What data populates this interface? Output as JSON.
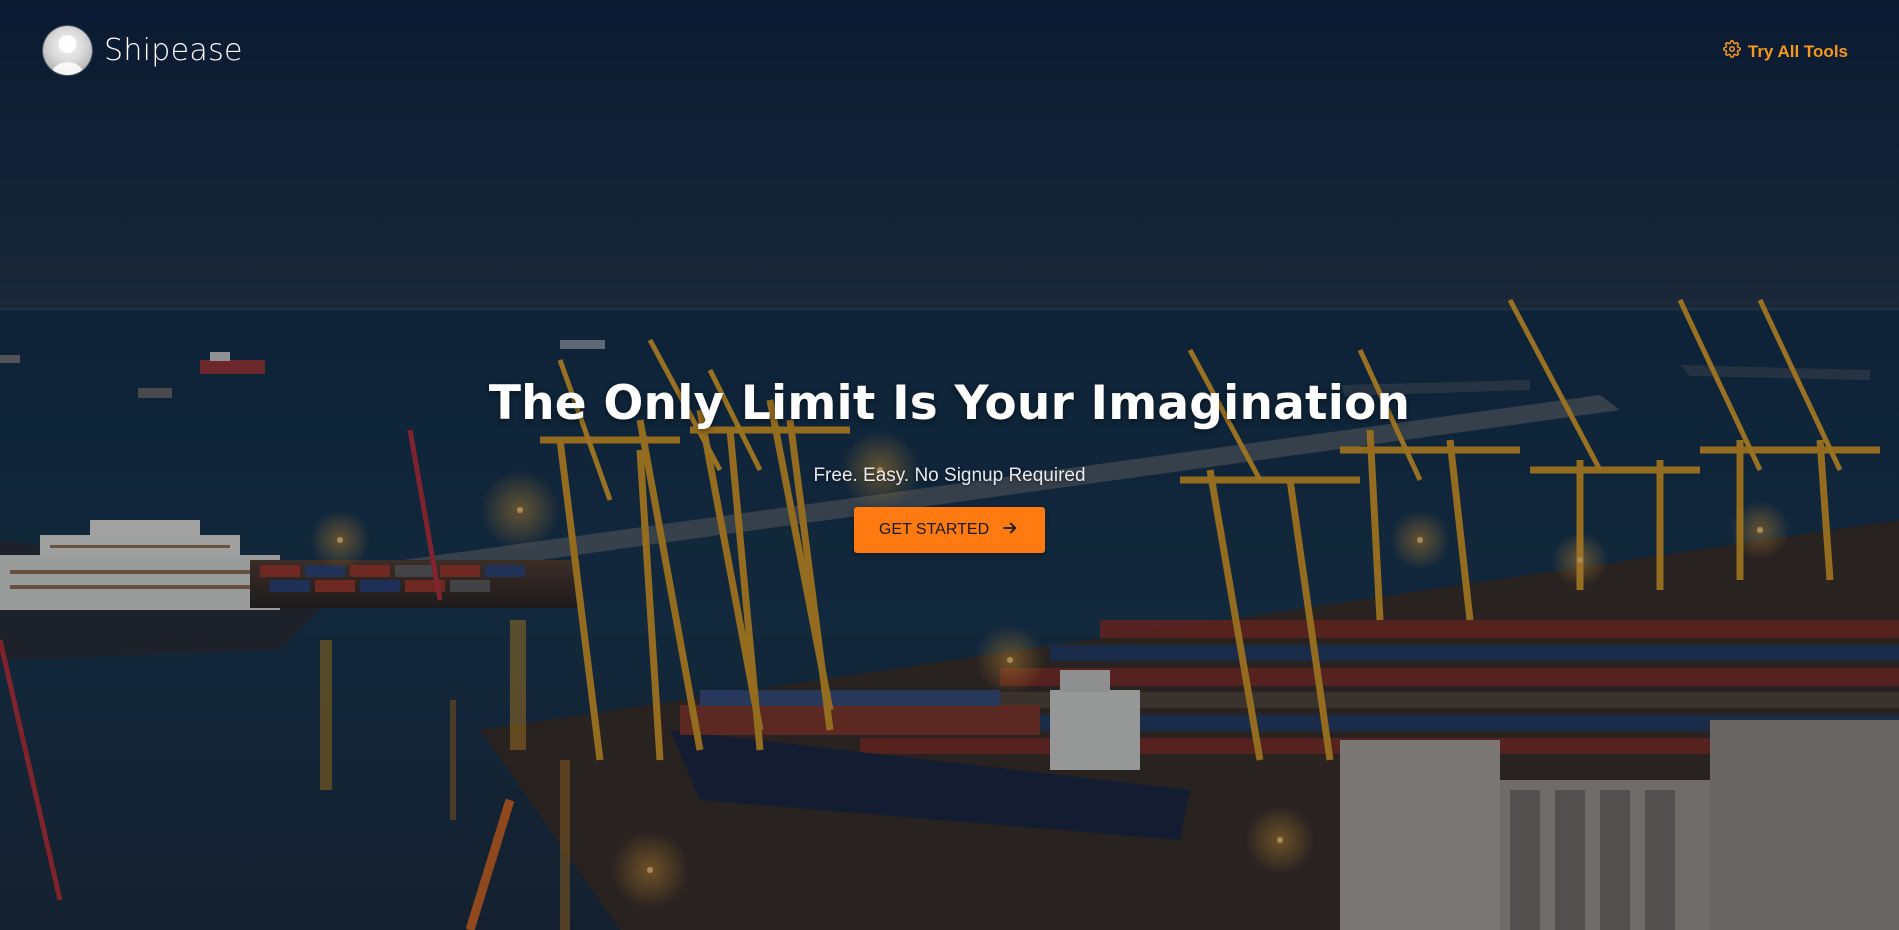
{
  "brand": {
    "name": "Shipease",
    "logo_icon": "avatar-silhouette-icon"
  },
  "nav": {
    "try_tools_label": "Try All Tools",
    "try_tools_icon": "gear-icon",
    "accent_color": "#f39a1e"
  },
  "hero": {
    "headline": "The Only Limit Is Your Imagination",
    "subtitle": "Free. Easy. No Signup Required",
    "cta_label": "GET STARTED",
    "cta_icon": "arrow-right-icon",
    "cta_color": "#ff7a10",
    "background": "night-harbor-container-port-photo"
  }
}
